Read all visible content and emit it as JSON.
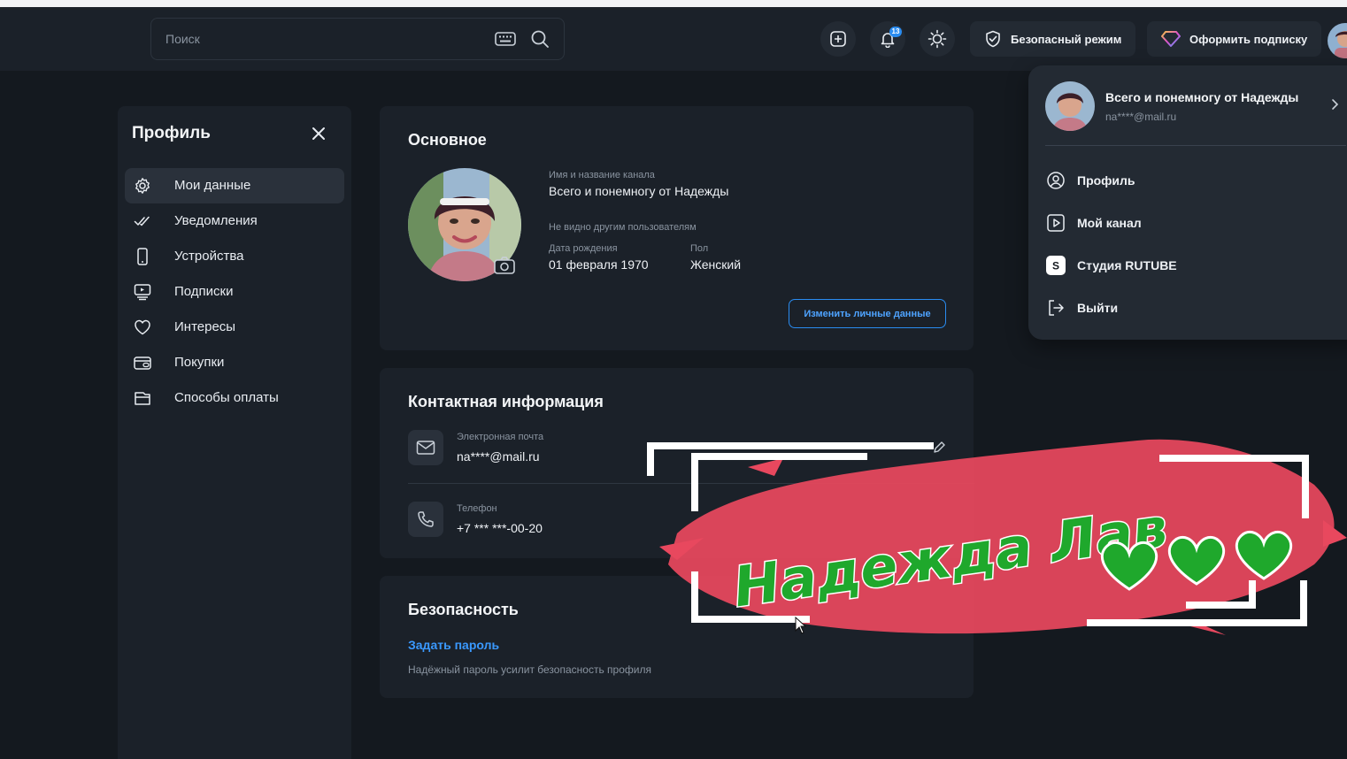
{
  "search": {
    "placeholder": "Поиск"
  },
  "header": {
    "notifications_count": "13",
    "safe_mode_label": "Безопасный режим",
    "subscribe_label": "Оформить подписку"
  },
  "sidebar": {
    "title": "Профиль",
    "items": [
      {
        "label": "Мои данные",
        "icon": "gear-icon",
        "active": true
      },
      {
        "label": "Уведомления",
        "icon": "double-check-icon"
      },
      {
        "label": "Устройства",
        "icon": "phone-icon"
      },
      {
        "label": "Подписки",
        "icon": "subscriptions-icon"
      },
      {
        "label": "Интересы",
        "icon": "heart-icon"
      },
      {
        "label": "Покупки",
        "icon": "wallet-icon"
      },
      {
        "label": "Способы оплаты",
        "icon": "card-icon"
      }
    ]
  },
  "main": {
    "basic": {
      "title": "Основное",
      "channel_name_label": "Имя и название канала",
      "channel_name": "Всего и понемногу от Надежды",
      "hidden_note": "Не видно другим пользователям",
      "birth_label": "Дата рождения",
      "birth_value": "01 февраля 1970",
      "gender_label": "Пол",
      "gender_value": "Женский",
      "edit_button": "Изменить личные данные"
    },
    "contact": {
      "title": "Контактная информация",
      "email_label": "Электронная почта",
      "email_value": "na****@mail.ru",
      "phone_label": "Телефон",
      "phone_value": "+7 *** ***-00-20"
    },
    "security": {
      "title": "Безопасность",
      "set_password": "Задать пароль",
      "hint": "Надёжный пароль усилит безопасность профиля"
    }
  },
  "dropdown": {
    "name": "Всего и понемногу от Надежды",
    "email": "na****@mail.ru",
    "items": [
      {
        "label": "Профиль",
        "icon": "user-circle-icon"
      },
      {
        "label": "Мой канал",
        "icon": "play-square-icon"
      },
      {
        "label": "Студия RUTUBE",
        "icon": "studio-icon"
      },
      {
        "label": "Выйти",
        "icon": "logout-icon"
      }
    ]
  },
  "overlay": {
    "text": "Надежда Лав",
    "accent": "#e8485e",
    "text_color": "#1fa82c"
  },
  "colors": {
    "accent": "#2a8cf0",
    "background": "#14191f",
    "panel": "#1b2129"
  }
}
